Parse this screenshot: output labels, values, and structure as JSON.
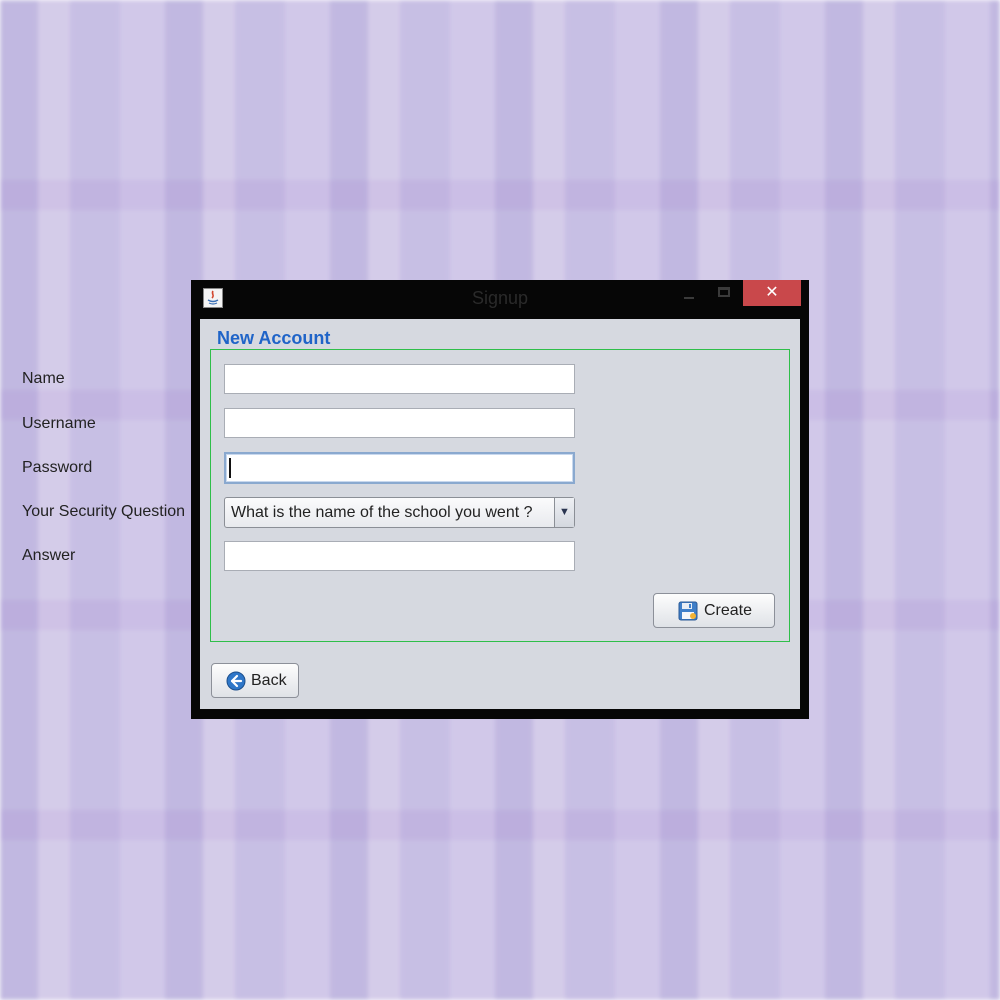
{
  "window": {
    "title": "Signup",
    "close_glyph": "✕"
  },
  "form": {
    "group_title": "New Account",
    "fields": {
      "name": {
        "label": "Name",
        "value": ""
      },
      "username": {
        "label": "Username",
        "value": ""
      },
      "password": {
        "label": "Password",
        "value": ""
      },
      "security_question": {
        "label": "Your Security Question",
        "selected": "What is the name of the school you went ?",
        "arrow_glyph": "▼"
      },
      "answer": {
        "label": "Answer",
        "value": ""
      }
    },
    "create_button": {
      "label": "Create",
      "icon": "floppy-disk-icon"
    }
  },
  "back_button": {
    "label": "Back",
    "icon": "back-arrow-icon"
  },
  "colors": {
    "accent_blue": "#1f64c8",
    "group_border": "#2fbf4a",
    "close_red": "#c9484b"
  }
}
